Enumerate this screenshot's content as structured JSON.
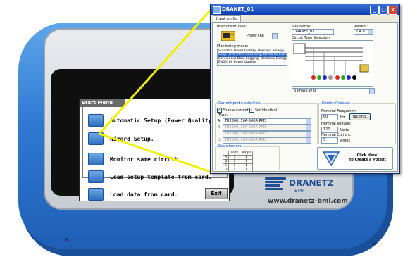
{
  "device": {
    "menu_title": "Start Menu",
    "menu_items": [
      {
        "label": "Automatic Setup (Power Quality)."
      },
      {
        "label": "Wizard Setup."
      },
      {
        "label": "Monitor same circuit."
      },
      {
        "label": "Load setup template from card."
      },
      {
        "label": "Load data from card."
      }
    ],
    "exit_label": "Exit",
    "brand": "DRANETZ",
    "brand_sub": "BMI",
    "url": "www.dranetz-bmi.com"
  },
  "window": {
    "title": "DRANET_01",
    "tab": "Input config",
    "instrument_type_label": "Instrument Type:",
    "instrument_type_value": "PowerXpe",
    "site_name_label": "Site Name:",
    "site_name_value": "DRANET_01",
    "version_label": "Version:",
    "version_value": "2.4.0",
    "circuit_type_label": "Circuit Type Selection:",
    "circuit_type_value": "3 Phase WYE",
    "monitoring_mode_label": "Monitoring mode:",
    "monitoring_modes": [
      "Standard Power Quality, Demand, Energy",
      "Long Term Trend Recording, Demand, Energy",
      "Continuous Data Logging, Demand, Energy",
      "EN50160 Power Quality"
    ],
    "monitoring_selected_index": 1,
    "current_probe_label": "Current probe selection:",
    "enable_currents_label": "Enable currents",
    "set_identical_label": "Set identical",
    "type_label": "Type:",
    "probes": [
      {
        "phase": "A",
        "value": "TR2500, 10A-500A RMS"
      },
      {
        "phase": "B",
        "value": "TR2500, 10A-500A RMS"
      },
      {
        "phase": "C",
        "value": "TR2500, 10A-500A RMS"
      },
      {
        "phase": "D",
        "value": "TR2500, 10A-500A RMS"
      }
    ],
    "nominal_values_label": "Nominal Values:",
    "nominal_frequency_label": "Nominal Frequency:",
    "nominal_frequency_value": "60",
    "hz_unit": "Hz",
    "tracking_label": "Tracking...",
    "nominal_voltage_label": "Nominal Voltage:",
    "nominal_voltage_value": "120",
    "volts_unit": "Volts",
    "nominal_current_label": "Nominal Current:",
    "nominal_current_value": "5",
    "amps_unit": "Amps",
    "scale_factors_label": "Scale factors:",
    "scale_headers": [
      "",
      "Volts",
      "Amps"
    ],
    "scale_rows": [
      {
        "ch": "A",
        "volts": "1",
        "amps": "1"
      },
      {
        "ch": "B",
        "volts": "1",
        "amps": "1"
      },
      {
        "ch": "C",
        "volts": "1",
        "amps": "1"
      },
      {
        "ch": "D",
        "volts": "1",
        "amps": "1"
      }
    ],
    "potent_line1": "Click Here!",
    "potent_line2": "to Create a Potent"
  },
  "colors": {
    "device_blue": "#2f78d2",
    "menu_button_blue": "#2d6fbf",
    "callout_yellow": "#f2f000",
    "titlebar_blue": "#0b3fb0"
  },
  "icons": [
    "device-icon",
    "circuit-diagram",
    "potent-icon",
    "minimize-icon",
    "maximize-icon",
    "close-icon",
    "dropdown-arrow-icon"
  ]
}
